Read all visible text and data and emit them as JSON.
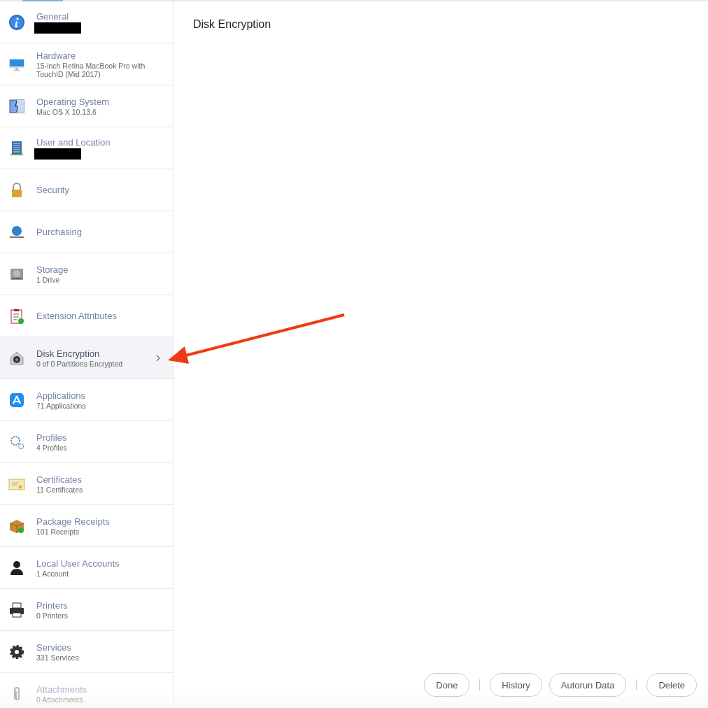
{
  "sidebar": {
    "items": [
      {
        "title": "General",
        "redacted": true,
        "selected": false
      },
      {
        "title": "Hardware",
        "subtitle": "15-inch Retina MacBook Pro with TouchID (Mid 2017)",
        "selected": false
      },
      {
        "title": "Operating System",
        "subtitle": "Mac OS X 10.13.6",
        "selected": false
      },
      {
        "title": "User and Location",
        "redacted": true,
        "selected": false
      },
      {
        "title": "Security",
        "selected": false
      },
      {
        "title": "Purchasing",
        "selected": false
      },
      {
        "title": "Storage",
        "subtitle": "1 Drive",
        "selected": false
      },
      {
        "title": "Extension Attributes",
        "selected": false
      },
      {
        "title": "Disk Encryption",
        "subtitle": "0 of 0 Partitions Encrypted",
        "selected": true
      },
      {
        "title": "Applications",
        "subtitle": "71 Applications",
        "selected": false
      },
      {
        "title": "Profiles",
        "subtitle": "4 Profiles",
        "selected": false
      },
      {
        "title": "Certificates",
        "subtitle": "11 Certificates",
        "selected": false
      },
      {
        "title": "Package Receipts",
        "subtitle": "101 Receipts",
        "selected": false
      },
      {
        "title": "Local User Accounts",
        "subtitle": "1 Account",
        "selected": false
      },
      {
        "title": "Printers",
        "subtitle": "0 Printers",
        "selected": false
      },
      {
        "title": "Services",
        "subtitle": "331 Services",
        "selected": false
      },
      {
        "title": "Attachments",
        "subtitle": "0 Attachments",
        "selected": false
      }
    ]
  },
  "content": {
    "title": "Disk Encryption"
  },
  "annotation": {
    "kind": "arrow"
  },
  "buttons": [
    {
      "label": "Done",
      "separator_before": false
    },
    {
      "label": "History",
      "separator_before": true
    },
    {
      "label": "Autorun Data",
      "separator_before": false
    },
    {
      "label": "Delete",
      "separator_before": true
    }
  ]
}
